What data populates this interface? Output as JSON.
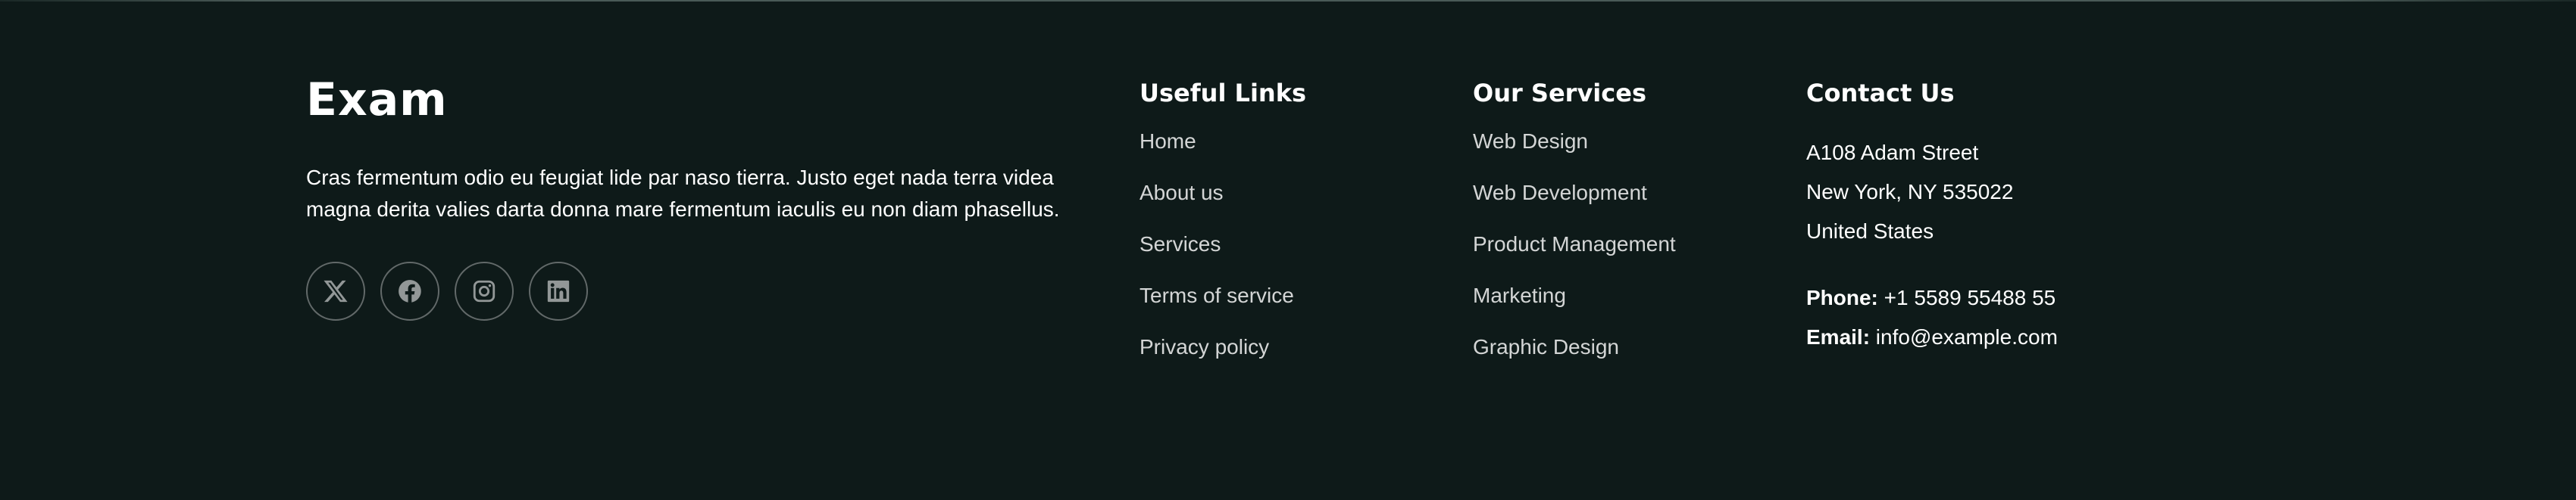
{
  "brand": {
    "name": "Exam",
    "description": "Cras fermentum odio eu feugiat lide par naso tierra. Justo eget nada terra videa magna derita valies darta donna mare fermentum iaculis eu non diam phasellus."
  },
  "socials": [
    {
      "icon": "x-twitter-icon"
    },
    {
      "icon": "facebook-icon"
    },
    {
      "icon": "instagram-icon"
    },
    {
      "icon": "linkedin-icon"
    }
  ],
  "useful_links": {
    "title": "Useful Links",
    "items": [
      "Home",
      "About us",
      "Services",
      "Terms of service",
      "Privacy policy"
    ]
  },
  "services": {
    "title": "Our Services",
    "items": [
      "Web Design",
      "Web Development",
      "Product Management",
      "Marketing",
      "Graphic Design"
    ]
  },
  "contact": {
    "title": "Contact Us",
    "address_line1": "A108 Adam Street",
    "address_line2": "New York, NY 535022",
    "address_line3": "United States",
    "phone_label": "Phone:",
    "phone_value": " +1 5589 55488 55",
    "email_label": "Email:",
    "email_value": " info@example.com"
  },
  "colors": {
    "background": "#0e1a19",
    "text": "#ffffff"
  }
}
